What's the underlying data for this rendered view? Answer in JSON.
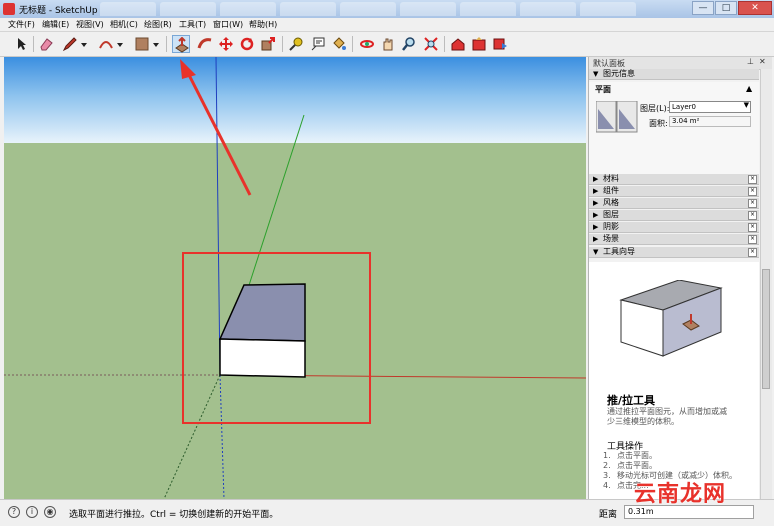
{
  "window": {
    "title": "无标题 - SketchUp",
    "min_label": "—",
    "max_label": "□",
    "close_label": "✕"
  },
  "menu": [
    {
      "label": "文件(F)"
    },
    {
      "label": "编辑(E)"
    },
    {
      "label": "视图(V)"
    },
    {
      "label": "相机(C)"
    },
    {
      "label": "绘图(R)"
    },
    {
      "label": "工具(T)"
    },
    {
      "label": "窗口(W)"
    },
    {
      "label": "帮助(H)"
    }
  ],
  "toolbar": {
    "tools": [
      {
        "icon": "select-arrow-icon"
      },
      {
        "icon": "eraser-icon"
      },
      {
        "icon": "pencil-line-icon"
      },
      {
        "icon": "arc-icon"
      },
      {
        "icon": "rectangle-shape-icon"
      },
      {
        "icon": "push-pull-icon",
        "active": true
      },
      {
        "icon": "follow-me-icon"
      },
      {
        "icon": "move-icon"
      },
      {
        "icon": "rotate-icon"
      },
      {
        "icon": "scale-icon"
      },
      {
        "icon": "tape-measure-icon"
      },
      {
        "icon": "text-label-icon"
      },
      {
        "icon": "paint-bucket-icon"
      },
      {
        "icon": "orbit-icon"
      },
      {
        "icon": "pan-hand-icon"
      },
      {
        "icon": "zoom-icon"
      },
      {
        "icon": "zoom-extents-icon"
      },
      {
        "icon": "warehouse-icon"
      },
      {
        "icon": "share-model-icon"
      },
      {
        "icon": "components-icon"
      }
    ]
  },
  "panel": {
    "title": "默认面板",
    "entity_info": {
      "header": "图元信息",
      "entity_type": "平面",
      "layer_label": "图层(L):",
      "layer_value": "Layer0",
      "area_label": "面积:",
      "area_value": "3.04 m²"
    },
    "trays": [
      {
        "label": "材料"
      },
      {
        "label": "组件"
      },
      {
        "label": "风格"
      },
      {
        "label": "图层"
      },
      {
        "label": "阴影"
      },
      {
        "label": "场景"
      }
    ],
    "instructor": {
      "header": "工具向导",
      "tool_name": "推/拉工具",
      "description": "通过推拉平面图元，从而增加或减少三维模型的体积。",
      "ops_title": "工具操作",
      "steps": [
        {
          "num": "1.",
          "text": "点击平面。"
        },
        {
          "num": "2.",
          "text": "点击平面。"
        },
        {
          "num": "3.",
          "text": "移动光标可创建（或减少）体积。"
        },
        {
          "num": "4.",
          "text": "点击完..."
        }
      ]
    }
  },
  "status": {
    "text": "选取平面进行推拉。Ctrl = 切换创建新的开始平面。",
    "distance_label": "距离",
    "distance_value": "0.31m"
  },
  "watermark": "云南龙网",
  "colors": {
    "sky_top": "#3b8fe0",
    "ground": "#a3c08e",
    "annotation_red": "#e8322b",
    "axis_red": "#c0392b",
    "axis_green": "#2ca02c",
    "axis_blue": "#1f3fbf"
  }
}
